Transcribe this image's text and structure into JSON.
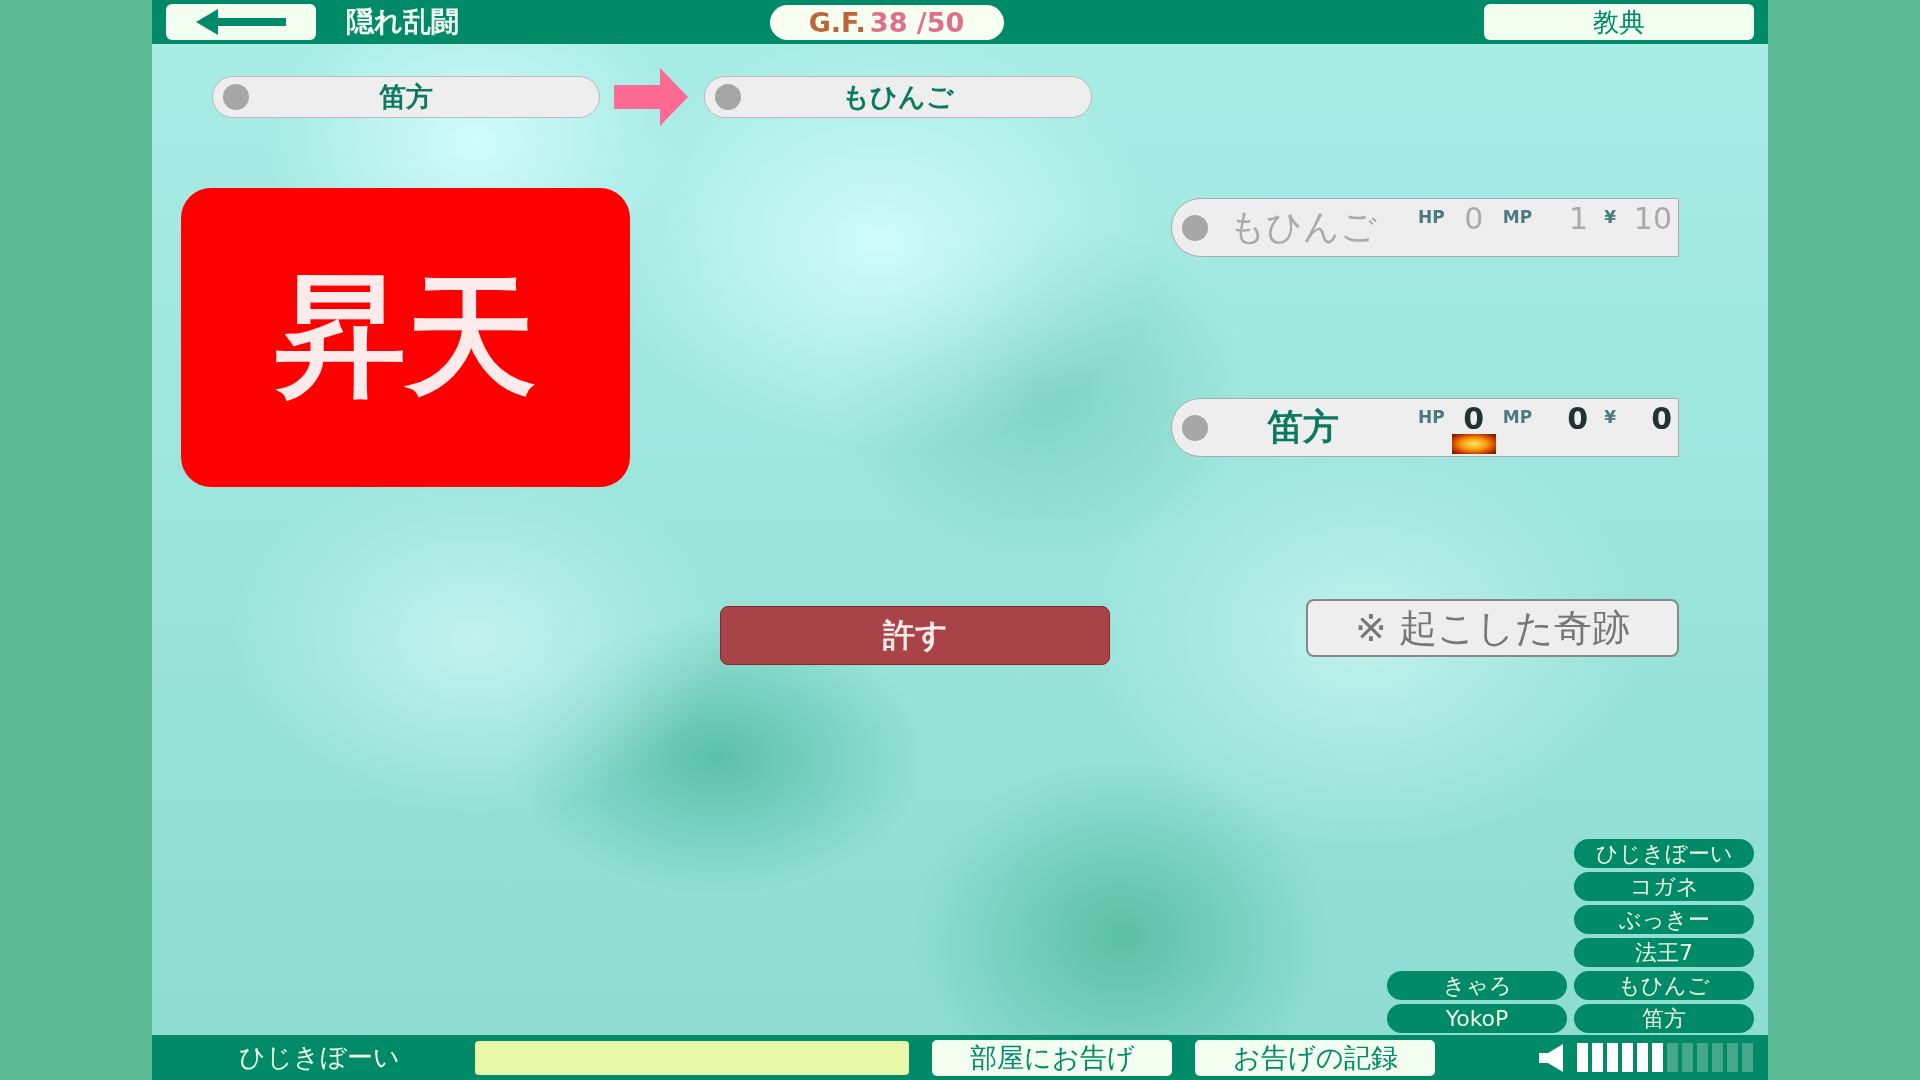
{
  "header": {
    "title": "隠れ乱闘",
    "gf_label": "G.F.",
    "gf_value": "38 /50",
    "scripture_button": "教典"
  },
  "transfer": {
    "from": "笛方",
    "to": "もひんご"
  },
  "verdict": "昇天",
  "players": [
    {
      "name": "もひんご",
      "dimmed": true,
      "hp_label": "HP",
      "hp": "0",
      "mp_label": "MP",
      "mp": "1",
      "money_label": "¥",
      "money": "10",
      "has_item": false
    },
    {
      "name": "笛方",
      "dimmed": false,
      "hp_label": "HP",
      "hp": "0",
      "mp_label": "MP",
      "mp": "0",
      "money_label": "¥",
      "money": "0",
      "has_item": true
    }
  ],
  "forgive_button": "許す",
  "miracle_button": "※ 起こした奇跡",
  "members": {
    "left": [
      "きゃろ",
      "YokoP"
    ],
    "right": [
      "ひじきぼーい",
      "コガネ",
      "ぶっきー",
      "法王7",
      "もひんご",
      "笛方"
    ]
  },
  "footer": {
    "user": "ひじきぼーい",
    "announce_button": "部屋にお告げ",
    "log_button": "お告げの記録",
    "volume": {
      "level": 0.5
    }
  }
}
